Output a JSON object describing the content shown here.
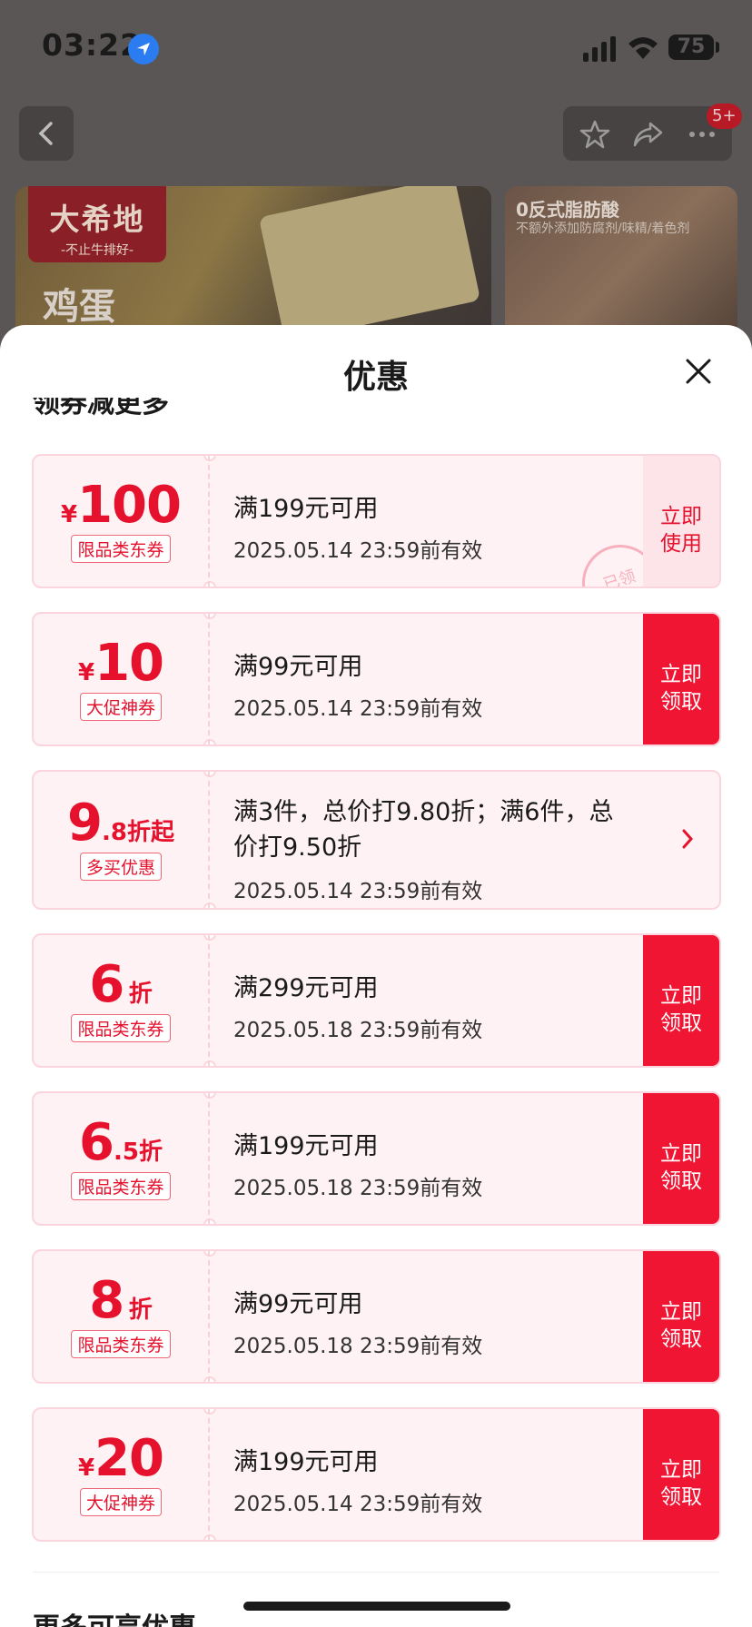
{
  "status_bar": {
    "time": "03:22",
    "battery": "75"
  },
  "header": {
    "notification_badge": "5+"
  },
  "banners": {
    "left_logo_main": "大希地",
    "left_logo_sub": "-不止牛排好-",
    "left_caption": "鸡蛋",
    "right_title": "0反式脂肪酸",
    "right_subtitle": "不额外添加防腐剂/味精/着色剂"
  },
  "sheet": {
    "title": "优惠",
    "cut_heading": "领券减更多",
    "more_heading": "更多可享优惠"
  },
  "coupons": [
    {
      "currency": "¥",
      "amount": "100",
      "amount_suffix": "",
      "tag": "限品类东券",
      "condition": "满199元可用",
      "validity": "2025.05.14 23:59前有效",
      "cta_line1": "立即",
      "cta_line2": "使用",
      "state": "claimed",
      "stamp": "已领"
    },
    {
      "currency": "¥",
      "amount": "10",
      "amount_suffix": "",
      "tag": "大促神券",
      "condition": "满99元可用",
      "validity": "2025.05.14 23:59前有效",
      "cta_line1": "立即",
      "cta_line2": "领取",
      "state": "available"
    },
    {
      "currency": "",
      "amount": "9",
      "amount_suffix": ".8折起",
      "tag": "多买优惠",
      "condition_line1": "满3件，总价打9.80折；满6件，总",
      "condition_line2": "价打9.50折",
      "validity": "2025.05.14 23:59前有效",
      "state": "info"
    },
    {
      "currency": "",
      "amount": "6",
      "amount_suffix": "折",
      "tag": "限品类东券",
      "condition": "满299元可用",
      "validity": "2025.05.18 23:59前有效",
      "cta_line1": "立即",
      "cta_line2": "领取",
      "state": "available"
    },
    {
      "currency": "",
      "amount": "6",
      "amount_suffix": ".5折",
      "tag": "限品类东券",
      "condition": "满199元可用",
      "validity": "2025.05.18 23:59前有效",
      "cta_line1": "立即",
      "cta_line2": "领取",
      "state": "available"
    },
    {
      "currency": "",
      "amount": "8",
      "amount_suffix": "折",
      "tag": "限品类东券",
      "condition": "满99元可用",
      "validity": "2025.05.18 23:59前有效",
      "cta_line1": "立即",
      "cta_line2": "领取",
      "state": "available"
    },
    {
      "currency": "¥",
      "amount": "20",
      "amount_suffix": "",
      "tag": "大促神券",
      "condition": "满199元可用",
      "validity": "2025.05.14 23:59前有效",
      "cta_line1": "立即",
      "cta_line2": "领取",
      "state": "available"
    }
  ],
  "colors": {
    "accent_red": "#ef1533",
    "coupon_bg": "#fff2f4",
    "coupon_border": "#fbd5dd"
  },
  "icons": [
    "location-arrow-icon",
    "signal-icon",
    "wifi-icon",
    "battery-icon",
    "back-chevron-icon",
    "star-icon",
    "share-icon",
    "more-dots-icon",
    "close-icon",
    "chevron-right-icon"
  ]
}
